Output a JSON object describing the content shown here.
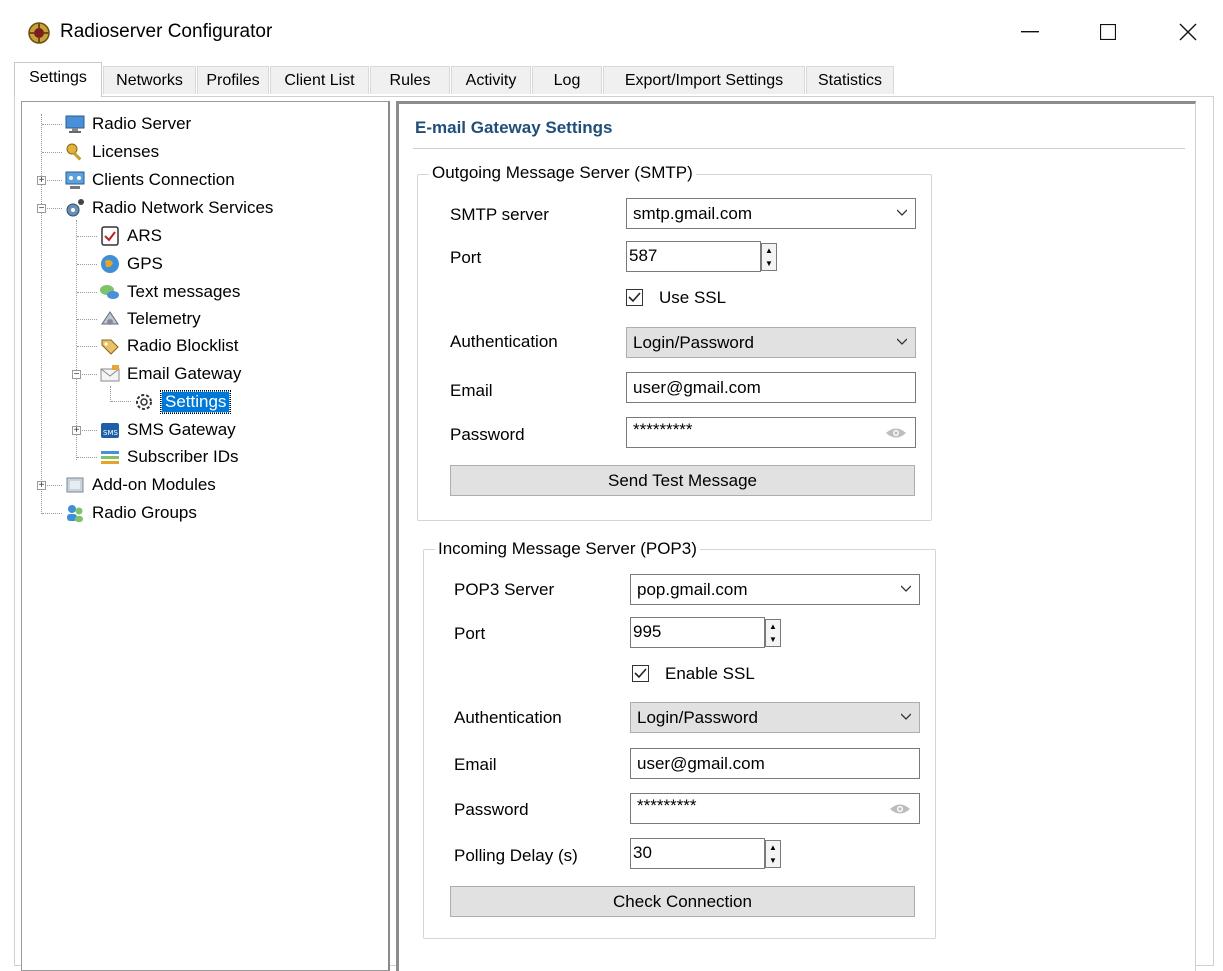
{
  "window": {
    "title": "Radioserver Configurator",
    "minimize": "—",
    "maximize": "☐",
    "close": "✕"
  },
  "tabs": [
    "Settings",
    "Networks",
    "Profiles",
    "Client List",
    "Rules",
    "Activity",
    "Log",
    "Export/Import Settings",
    "Statistics"
  ],
  "tree": {
    "radio_server": "Radio Server",
    "licenses": "Licenses",
    "clients_connection": "Clients Connection",
    "radio_network_services": "Radio Network Services",
    "ars": "ARS",
    "gps": "GPS",
    "text_messages": "Text messages",
    "telemetry": "Telemetry",
    "radio_blocklist": "Radio Blocklist",
    "email_gateway": "Email Gateway",
    "settings": "Settings",
    "sms_gateway": "SMS Gateway",
    "subscriber_ids": "Subscriber IDs",
    "addon_modules": "Add-on Modules",
    "radio_groups": "Radio Groups"
  },
  "panel": {
    "title": "E-mail Gateway Settings",
    "smtp": {
      "legend": "Outgoing Message Server (SMTP)",
      "server_label": "SMTP server",
      "server_value": "smtp.gmail.com",
      "port_label": "Port",
      "port_value": "587",
      "ssl_label": "Use SSL",
      "auth_label": "Authentication",
      "auth_value": "Login/Password",
      "email_label": "Email",
      "email_value": "user@gmail.com",
      "password_label": "Password",
      "password_value": "*********",
      "test_button": "Send Test Message"
    },
    "pop3": {
      "legend": "Incoming Message Server (POP3)",
      "server_label": "POP3 Server",
      "server_value": "pop.gmail.com",
      "port_label": "Port",
      "port_value": "995",
      "ssl_label": "Enable SSL",
      "auth_label": "Authentication",
      "auth_value": "Login/Password",
      "email_label": "Email",
      "email_value": "user@gmail.com",
      "password_label": "Password",
      "password_value": "*********",
      "polling_label": "Polling Delay (s)",
      "polling_value": "30",
      "check_button": "Check Connection"
    }
  }
}
